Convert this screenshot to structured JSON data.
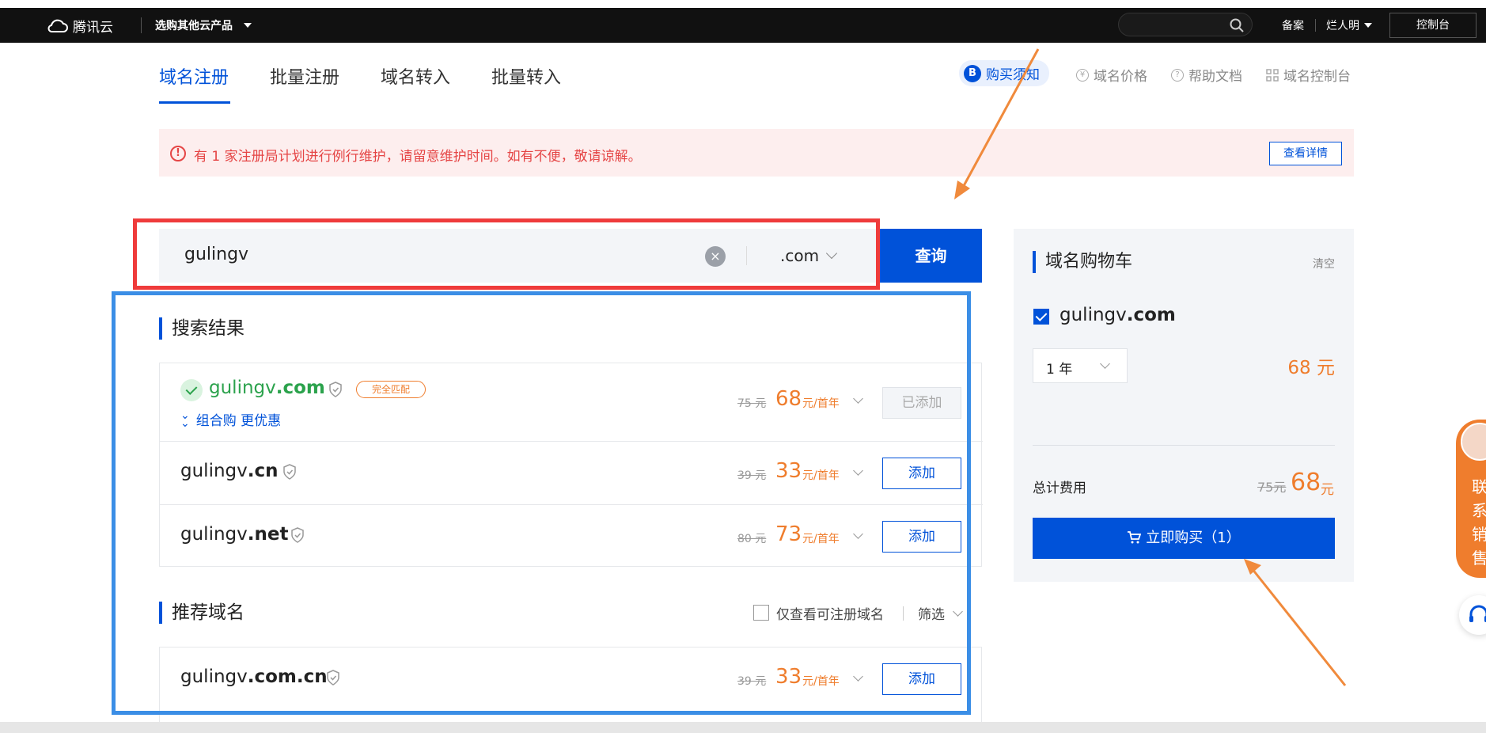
{
  "topbar": {
    "brand": "腾讯云",
    "product_menu": "选购其他云产品",
    "links": [
      "备案",
      "烂人明"
    ],
    "console": "控制台"
  },
  "nav": {
    "tabs": [
      "域名注册",
      "批量注册",
      "域名转入",
      "批量转入"
    ],
    "active_tab": 0,
    "right_links": [
      {
        "icon": "B",
        "label": "购买须知"
      },
      {
        "icon": "¥",
        "label": "域名价格"
      },
      {
        "icon": "?",
        "label": "帮助文档"
      },
      {
        "icon": "grid",
        "label": "域名控制台"
      }
    ]
  },
  "notice": {
    "message": "有 1 家注册局计划进行例行维护，请留意维护时间。如有不便，敬请谅解。",
    "detail_button": "查看详情"
  },
  "search": {
    "value": "gulingv",
    "tld": ".com",
    "query_button": "查询"
  },
  "results": {
    "title": "搜索结果",
    "items": [
      {
        "name": "gulingv",
        "tld": ".com",
        "tag": "完全匹配",
        "combo": "组合购 更优惠",
        "old_price": "75 元",
        "price": "68",
        "unit": "元/首年",
        "action": "已添加"
      },
      {
        "name": "gulingv",
        "tld": ".cn",
        "old_price": "39 元",
        "price": "33",
        "unit": "元/首年",
        "action": "添加"
      },
      {
        "name": "gulingv",
        "tld": ".net",
        "old_price": "80 元",
        "price": "73",
        "unit": "元/首年",
        "action": "添加"
      }
    ]
  },
  "recommend": {
    "title": "推荐域名",
    "filter_checkbox": "仅查看可注册域名",
    "filter": "筛选",
    "items": [
      {
        "name": "gulingv",
        "tld": ".com.cn",
        "old_price": "39 元",
        "price": "33",
        "unit": "元/首年",
        "action": "添加"
      }
    ]
  },
  "cart": {
    "title": "域名购物车",
    "clear": "清空",
    "domain_name": "gulingv",
    "domain_tld": ".com",
    "period": "1 年",
    "price": "68 元",
    "total_label": "总计费用",
    "total_old": "75元",
    "total_new": "68",
    "total_unit": "元",
    "buy_button": "立即购买（1）"
  },
  "float": {
    "contact": "联系销售"
  },
  "colors": {
    "accent": "#0052d9",
    "price": "#ef7d2d",
    "success": "#2ba24c",
    "annotation_red": "#ef3b3b",
    "annotation_blue": "#3b8ee6",
    "annotation_arrow": "#f08a3c"
  }
}
